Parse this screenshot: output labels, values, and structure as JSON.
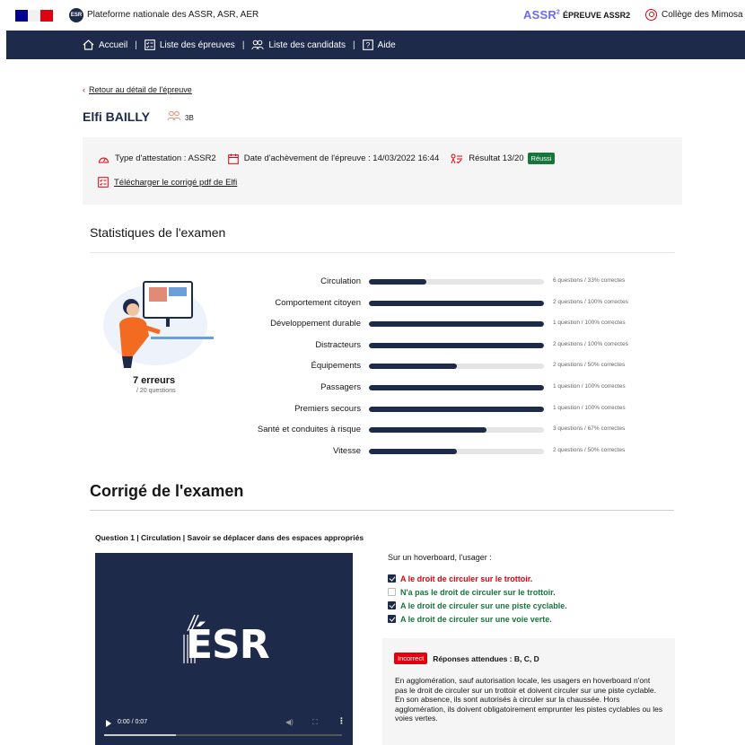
{
  "header": {
    "platform_title": "Plateforme nationale des ASSR, ASR, AER",
    "esr_badge": "ESR",
    "assr_logo": "ASSR",
    "assr_logo_sup": "2",
    "epreuve_label": "ÉPREUVE ASSR2",
    "school_name": "Collège des Mimosa"
  },
  "nav": {
    "items": [
      {
        "label": "Accueil",
        "icon": "home-icon"
      },
      {
        "label": "Liste des épreuves",
        "icon": "checklist-icon"
      },
      {
        "label": "Liste des candidats",
        "icon": "people-icon"
      },
      {
        "label": "Aide",
        "icon": "help-icon"
      }
    ],
    "separator": "|"
  },
  "candidate": {
    "back_link": "Retour au détail de l'épreuve",
    "name": "Elfi BAILLY",
    "class": "3B"
  },
  "info": {
    "attestation": "Type d'attestation : ASSR2",
    "date": "Date d'achèvement de l'épreuve : 14/03/2022 16:44",
    "result": "Résultat 13/20",
    "result_badge": "Réussi",
    "download_link": "Télécharger le corrigé pdf de Elfi"
  },
  "stats": {
    "title": "Statistiques de l'examen",
    "errors": "7 erreurs",
    "errors_sub": "/ 20 questions",
    "rows": [
      {
        "label": "Circulation",
        "fill": 0.33,
        "detail": "6 questions / 33% correctes"
      },
      {
        "label": "Comportement citoyen",
        "fill": 1.0,
        "detail": "2 questions / 100% correctes"
      },
      {
        "label": "Développement durable",
        "fill": 1.0,
        "detail": "1 question / 100% correctes"
      },
      {
        "label": "Distracteurs",
        "fill": 1.0,
        "detail": "2 questions / 100% correctes"
      },
      {
        "label": "Équipements",
        "fill": 0.5,
        "detail": "2 questions / 50% correctes"
      },
      {
        "label": "Passagers",
        "fill": 1.0,
        "detail": "1 question / 100% correctes"
      },
      {
        "label": "Premiers secours",
        "fill": 1.0,
        "detail": "1 question / 100% correctes"
      },
      {
        "label": "Santé et conduites à risque",
        "fill": 0.67,
        "detail": "3 questions / 67% correctes"
      },
      {
        "label": "Vitesse",
        "fill": 0.5,
        "detail": "2 questions / 50% correctes"
      }
    ]
  },
  "corrige": {
    "title": "Corrigé de l'examen",
    "question_head": "Question 1 | Circulation | Savoir se déplacer dans des espaces appropriés",
    "video": {
      "logo": "ÉSR",
      "time": "0:00 / 0:07",
      "progress": 0.3
    },
    "prompt": "Sur un hoverboard, l'usager :",
    "answers": [
      {
        "text": "A le droit de circuler sur le trottoir.",
        "checked": true,
        "color": "red"
      },
      {
        "text": "N'a pas le droit de circuler sur le trottoir.",
        "checked": false,
        "color": "green"
      },
      {
        "text": "A le droit de circuler sur une piste cyclable.",
        "checked": true,
        "color": "green"
      },
      {
        "text": "A le droit de circuler sur une voie verte.",
        "checked": true,
        "color": "green"
      }
    ],
    "explain_badge": "Incorrect",
    "expected": "Réponses attendues : B, C, D",
    "explanation": "En agglomération, sauf autorisation locale, les usagers en hoverboard n'ont pas le droit de circuler sur un trottoir et doivent circuler sur une piste cyclable. En son absence, ils sont autorisés à circuler sur la chaussée. Hors agglomération, ils doivent obligatoirement emprunter les pistes cyclables ou les voies vertes."
  },
  "colors": {
    "navy": "#1e2a4a",
    "red": "#e1000f",
    "green": "#18753c"
  }
}
